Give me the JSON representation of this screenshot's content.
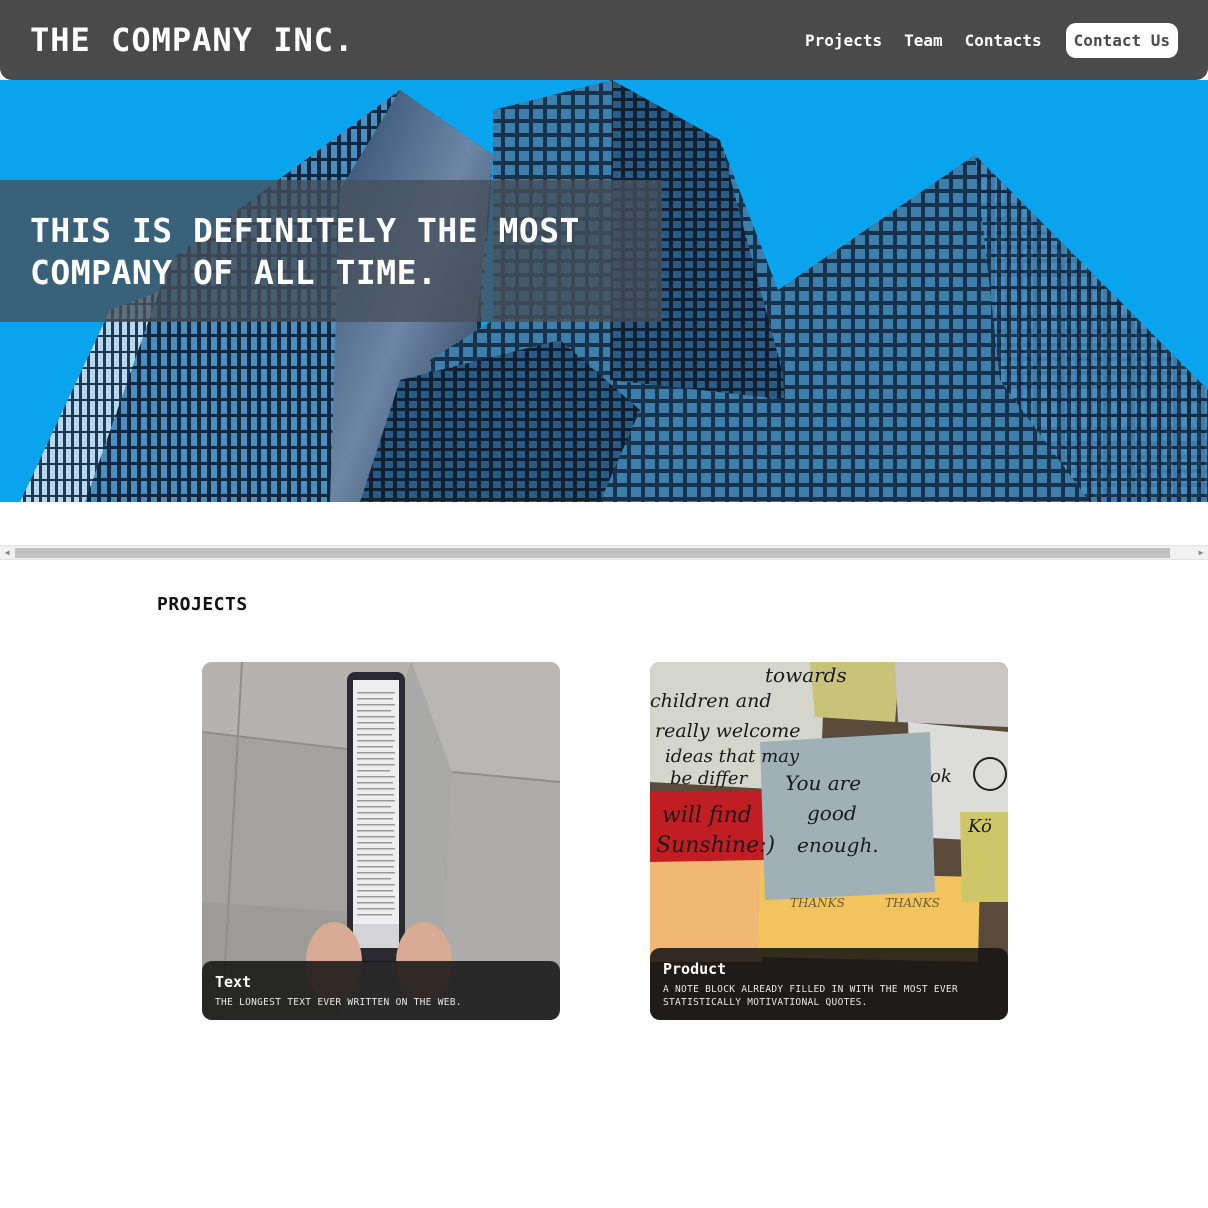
{
  "header": {
    "logo": "THE COMPANY INC.",
    "nav": {
      "projects": "Projects",
      "team": "Team",
      "contacts": "Contacts",
      "contact_us": "Contact Us"
    }
  },
  "hero": {
    "title_line1": "THIS IS DEFINITELY THE MOST",
    "title_line2": "COMPANY OF ALL TIME.",
    "image": "skyscrapers-photo"
  },
  "projects": {
    "heading": "PROJECTS",
    "cards": [
      {
        "title": "Text",
        "description": "The longest text ever written on the web.",
        "image": "long-phone-photo"
      },
      {
        "title": "Product",
        "description": "A note block already filled in with the most ever statistically motivational quotes.",
        "image": "sticky-notes-photo"
      }
    ],
    "note_texts": [
      "You are",
      "good",
      "enough.",
      "towards",
      "children and",
      "really welcome",
      "ideas that may",
      "be differ",
      "will find",
      "Sunshine:)",
      "THANKS",
      "THANKS",
      "ok",
      "Kö"
    ]
  },
  "colors": {
    "header_bg": "#4a4a4a",
    "sky": "#0aa3ee",
    "banner": "#46505a",
    "card_caption": "#141414"
  }
}
